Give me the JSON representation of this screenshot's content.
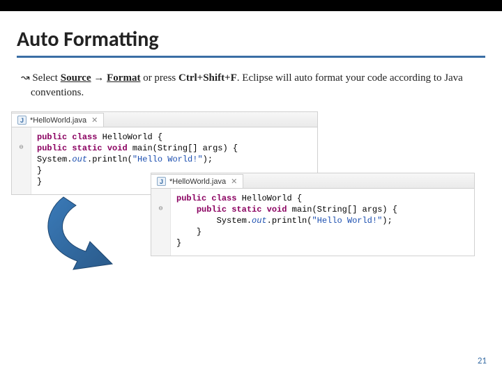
{
  "slide": {
    "title": "Auto Formatting",
    "bullet_prefix": "↝",
    "instruction": {
      "pre": "Select ",
      "menu1": "Source",
      "arrow": " → ",
      "menu2": "Format",
      "mid": " or press ",
      "shortcut": "Ctrl+Shift+F",
      "post": ". Eclipse will auto format your code according to Java conventions."
    },
    "page_number": "21"
  },
  "editor_before": {
    "tab_label": "*HelloWorld.java",
    "fold_symbol": "⊖",
    "code": {
      "l1_kw1": "public",
      "l1_kw2": "class",
      "l1_cls": "HelloWorld",
      "l1_open": " {",
      "l2_kw1": "public",
      "l2_kw2": "static",
      "l2_kw3": "void",
      "l2_m": "main(String[] args) {",
      "l3_pre": "System.",
      "l3_out": "out",
      "l3_call": ".println(",
      "l3_str": "\"Hello World!\"",
      "l3_end": ");",
      "l4": "}",
      "l5": "}"
    }
  },
  "editor_after": {
    "tab_label": "*HelloWorld.java",
    "fold_symbol": "⊖",
    "code": {
      "l1_kw1": "public",
      "l1_kw2": "class",
      "l1_cls": "HelloWorld",
      "l1_open": " {",
      "l2_kw1": "public",
      "l2_kw2": "static",
      "l2_kw3": "void",
      "l2_m": "main(String[] args) {",
      "l3_pre": "System.",
      "l3_out": "out",
      "l3_call": ".println(",
      "l3_str": "\"Hello World!\"",
      "l3_end": ");",
      "l4": "}",
      "l5": "}"
    }
  }
}
